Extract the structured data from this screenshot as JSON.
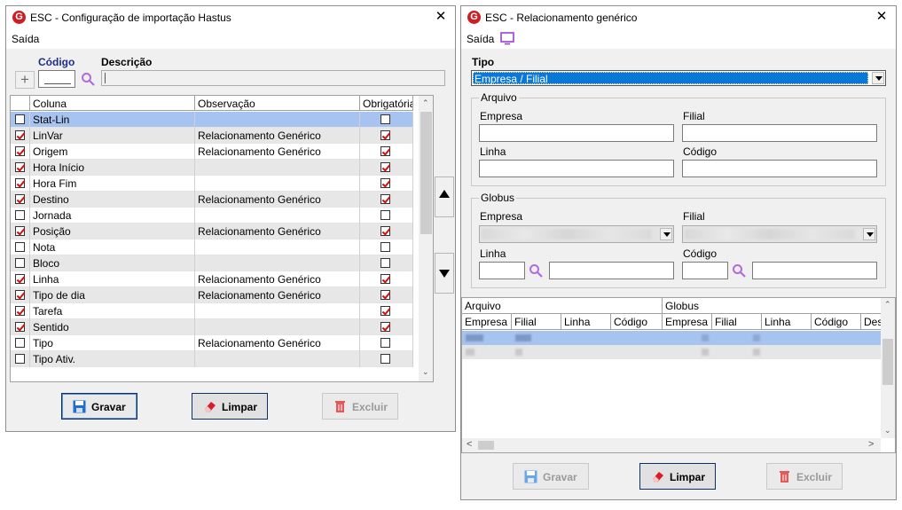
{
  "left_window": {
    "title": "ESC - Configuração de importação Hastus",
    "app_icon": "G",
    "menu": [
      "Saída"
    ],
    "codigo_label": "Código",
    "descricao_label": "Descrição",
    "grid": {
      "columns": [
        "",
        "Coluna",
        "Observação",
        "Obrigatória"
      ],
      "rows": [
        {
          "checked": false,
          "coluna": "Stat-Lin",
          "obs": "",
          "obrig": false,
          "selected": true
        },
        {
          "checked": true,
          "coluna": "LinVar",
          "obs": "Relacionamento Genérico",
          "obrig": true
        },
        {
          "checked": true,
          "coluna": "Origem",
          "obs": "Relacionamento Genérico",
          "obrig": true
        },
        {
          "checked": true,
          "coluna": "Hora Início",
          "obs": "",
          "obrig": true
        },
        {
          "checked": true,
          "coluna": "Hora Fim",
          "obs": "",
          "obrig": true
        },
        {
          "checked": true,
          "coluna": "Destino",
          "obs": "Relacionamento Genérico",
          "obrig": true
        },
        {
          "checked": false,
          "coluna": "Jornada",
          "obs": "",
          "obrig": false
        },
        {
          "checked": true,
          "coluna": "Posição",
          "obs": "Relacionamento Genérico",
          "obrig": true
        },
        {
          "checked": false,
          "coluna": "Nota",
          "obs": "",
          "obrig": false
        },
        {
          "checked": false,
          "coluna": "Bloco",
          "obs": "",
          "obrig": false
        },
        {
          "checked": true,
          "coluna": "Linha",
          "obs": "Relacionamento Genérico",
          "obrig": true
        },
        {
          "checked": true,
          "coluna": "Tipo de dia",
          "obs": "Relacionamento Genérico",
          "obrig": true
        },
        {
          "checked": true,
          "coluna": "Tarefa",
          "obs": "",
          "obrig": true
        },
        {
          "checked": true,
          "coluna": "Sentido",
          "obs": "",
          "obrig": true
        },
        {
          "checked": false,
          "coluna": "Tipo",
          "obs": "Relacionamento Genérico",
          "obrig": false
        },
        {
          "checked": false,
          "coluna": "Tipo Ativ.",
          "obs": "",
          "obrig": false
        }
      ]
    },
    "buttons": {
      "gravar": "Gravar",
      "limpar": "Limpar",
      "excluir": "Excluir"
    }
  },
  "right_window": {
    "title": "ESC - Relacionamento genérico",
    "app_icon": "G",
    "menu": [
      "Saída"
    ],
    "tipo_label": "Tipo",
    "tipo_value": "Empresa / Filial",
    "arquivo": {
      "title": "Arquivo",
      "empresa": "Empresa",
      "filial": "Filial",
      "linha": "Linha",
      "codigo": "Código"
    },
    "globus": {
      "title": "Globus",
      "empresa": "Empresa",
      "filial": "Filial",
      "linha": "Linha",
      "codigo": "Código"
    },
    "grid": {
      "group_headers": [
        "Arquivo",
        "Globus"
      ],
      "columns": [
        "Empresa",
        "Filial",
        "Linha",
        "Código",
        "Empresa",
        "Filial",
        "Linha",
        "Código",
        "Des"
      ]
    },
    "buttons": {
      "gravar": "Gravar",
      "limpar": "Limpar",
      "excluir": "Excluir"
    }
  },
  "colors": {
    "selection": "#a7c4f0",
    "check_red": "#cc1010",
    "brand_red": "#cc1f25",
    "accent_purple": "#9b3fd6"
  }
}
